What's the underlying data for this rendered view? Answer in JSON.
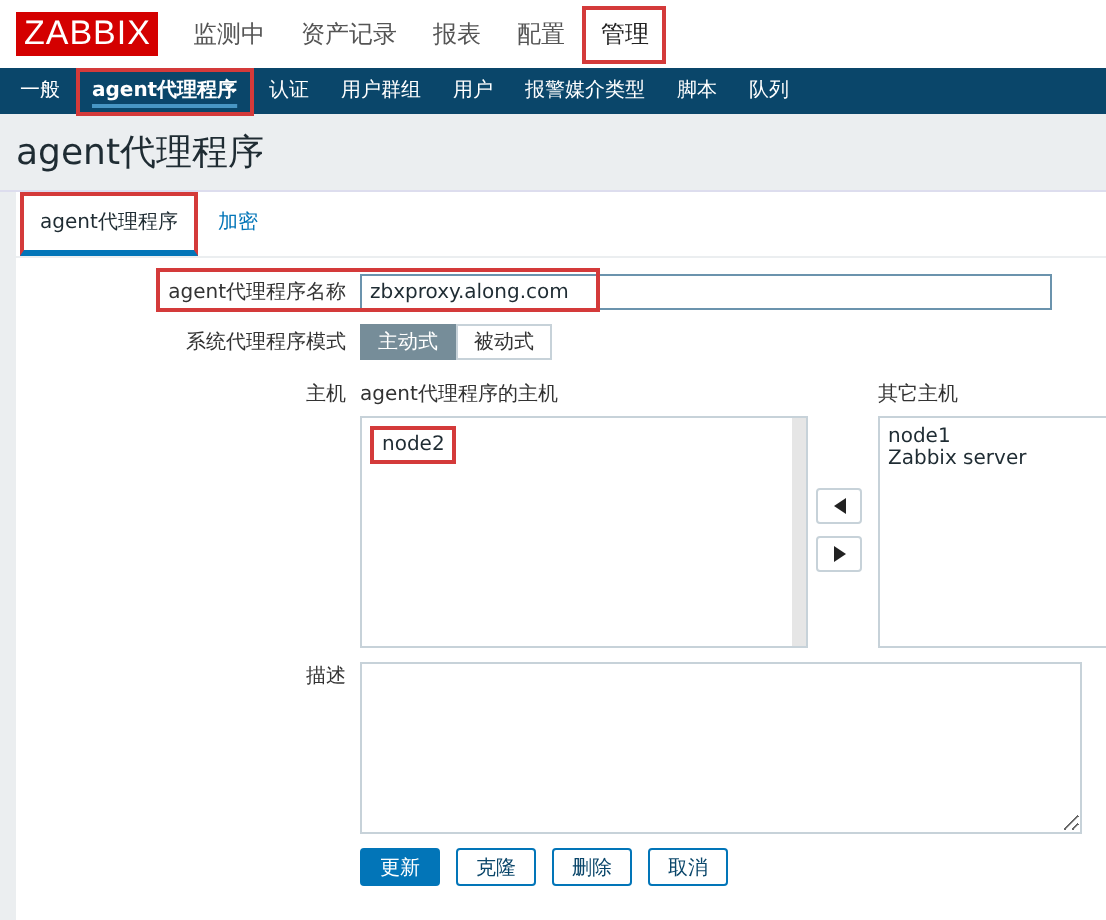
{
  "header": {
    "logo": "ZABBIX",
    "menu": [
      {
        "label": "监测中",
        "selected": false,
        "highlighted": false
      },
      {
        "label": "资产记录",
        "selected": false,
        "highlighted": false
      },
      {
        "label": "报表",
        "selected": false,
        "highlighted": false
      },
      {
        "label": "配置",
        "selected": false,
        "highlighted": false
      },
      {
        "label": "管理",
        "selected": true,
        "highlighted": true
      }
    ]
  },
  "subnav": [
    {
      "label": "一般",
      "selected": false,
      "highlighted": false
    },
    {
      "label": "agent代理程序",
      "selected": true,
      "highlighted": true
    },
    {
      "label": "认证",
      "selected": false,
      "highlighted": false
    },
    {
      "label": "用户群组",
      "selected": false,
      "highlighted": false
    },
    {
      "label": "用户",
      "selected": false,
      "highlighted": false
    },
    {
      "label": "报警媒介类型",
      "selected": false,
      "highlighted": false
    },
    {
      "label": "脚本",
      "selected": false,
      "highlighted": false
    },
    {
      "label": "队列",
      "selected": false,
      "highlighted": false
    }
  ],
  "page_title": "agent代理程序",
  "tabs": [
    {
      "label": "agent代理程序",
      "selected": true,
      "highlighted": true
    },
    {
      "label": "加密",
      "selected": false,
      "highlighted": false
    }
  ],
  "form": {
    "name": {
      "label": "agent代理程序名称",
      "value": "zbxproxy.along.com",
      "highlighted": true
    },
    "mode": {
      "label": "系统代理程序模式",
      "options": [
        {
          "label": "主动式",
          "selected": true
        },
        {
          "label": "被动式",
          "selected": false
        }
      ]
    },
    "hosts": {
      "label": "主机",
      "own_title": "agent代理程序的主机",
      "own": [
        {
          "name": "node2",
          "highlighted": true
        }
      ],
      "other_title": "其它主机",
      "other": [
        {
          "name": "node1"
        },
        {
          "name": "Zabbix server"
        }
      ]
    },
    "description": {
      "label": "描述"
    },
    "buttons": [
      {
        "label": "更新",
        "kind": "primary"
      },
      {
        "label": "克隆",
        "kind": "secondary"
      },
      {
        "label": "删除",
        "kind": "secondary"
      },
      {
        "label": "取消",
        "kind": "secondary"
      }
    ]
  }
}
